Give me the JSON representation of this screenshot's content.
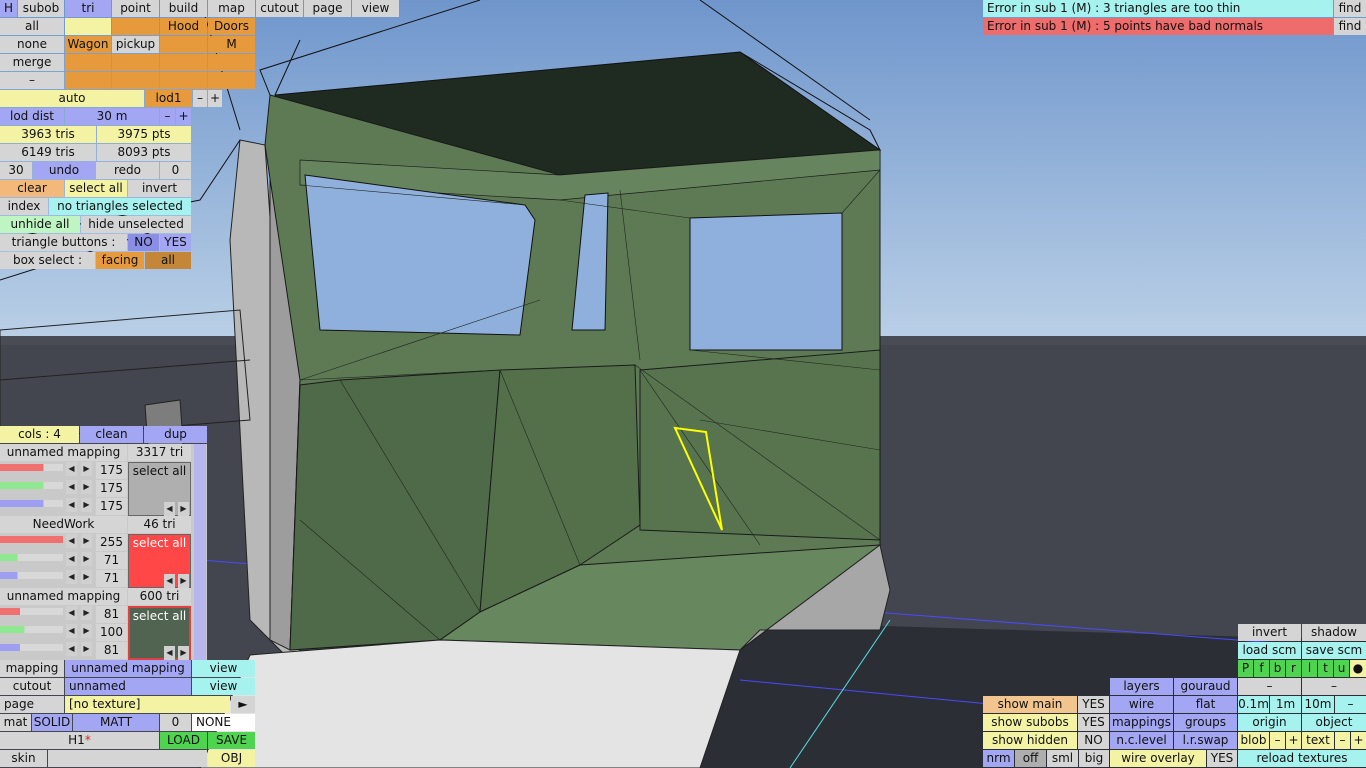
{
  "top_tabs": [
    "H",
    "subob",
    "tri",
    "point",
    "build",
    "map",
    "cutout",
    "page",
    "view"
  ],
  "groups": {
    "row1": [
      "all",
      "",
      "",
      "Hood",
      "Doors"
    ],
    "row2": [
      "none",
      "Wagon",
      "pickup",
      "",
      "M"
    ],
    "row3": [
      "merge",
      "",
      "",
      "",
      ""
    ],
    "row4": [
      "–",
      "",
      "",
      "",
      ""
    ]
  },
  "lod": {
    "auto": "auto",
    "lod": "lod1",
    "minus": "–",
    "plus": "+",
    "dist_label": "lod dist",
    "dist_value": "30 m"
  },
  "stats": {
    "tris1": "3963 tris",
    "pts1": "3975 pts",
    "tris2": "6149 tris",
    "pts2": "8093 pts"
  },
  "undo_row": {
    "count": "30",
    "undo": "undo",
    "redo": "redo",
    "zero": "0"
  },
  "select_row": {
    "clear": "clear",
    "select_all": "select all",
    "invert": "invert"
  },
  "index_row": {
    "index": "index",
    "status": "no triangles selected"
  },
  "hide_row": {
    "unhide": "unhide all",
    "hide": "hide unselected"
  },
  "tri_buttons": {
    "label": "triangle buttons :",
    "no": "NO",
    "yes": "YES"
  },
  "box_select": {
    "label": "box select :",
    "facing": "facing",
    "all": "all"
  },
  "colour_panel": {
    "cols": "cols : 4",
    "clean": "clean",
    "dup": "dup"
  },
  "mappings": [
    {
      "name": "unnamed mapping",
      "tri": "3317 tri",
      "r": "175",
      "g": "175",
      "b": "175",
      "select": "select all",
      "r_frac": 0.69,
      "g_frac": 0.69,
      "b_frac": 0.69,
      "swatch": "#afafaf"
    },
    {
      "name": "NeedWork",
      "tri": "46 tri",
      "r": "255",
      "g": "71",
      "b": "71",
      "select": "select all",
      "r_frac": 1.0,
      "g_frac": 0.28,
      "b_frac": 0.28,
      "swatch": "#ff4747"
    },
    {
      "name": "unnamed mapping",
      "tri": "600 tri",
      "r": "81",
      "g": "100",
      "b": "81",
      "select": "select all",
      "r_frac": 0.32,
      "g_frac": 0.39,
      "b_frac": 0.32,
      "swatch": "#516451"
    }
  ],
  "bottom_left": {
    "mapping_label": "mapping",
    "mapping_value": "unnamed mapping",
    "view1": "view",
    "cutout_label": "cutout",
    "cutout_value": "unnamed",
    "view2": "view",
    "page_label": "page",
    "page_value": "[no texture]",
    "page_arrow": "►",
    "mat": "mat",
    "solid": "SOLID",
    "matt": "MATT",
    "zero": "0",
    "none": "NONE",
    "name": "H1",
    "star": "*",
    "load": "LOAD",
    "save": "SAVE",
    "skin": "skin",
    "obj": "OBJ"
  },
  "errors": [
    {
      "text": "Error in sub 1 (M) : 3 triangles are too thin",
      "find": "find"
    },
    {
      "text": "Error in sub 1 (M) : 5 points have bad normals",
      "find": "find"
    }
  ],
  "bottom_right": {
    "invert": "invert",
    "shadow": "shadow",
    "load_scm": "load scm",
    "save_scm": "save scm",
    "letters": [
      "P",
      "f",
      "b",
      "r",
      "l",
      "t",
      "u",
      "●"
    ],
    "dash1": "–",
    "dash2": "–",
    "layers": "layers",
    "gouraud": "gouraud",
    "show_main": "show main",
    "yes1": "YES",
    "wire": "wire",
    "flat": "flat",
    "d01": "0.1m",
    "d1": "1m",
    "d10": "10m",
    "dm": "–",
    "show_subobs": "show subobs",
    "yes2": "YES",
    "mappings": "mappings",
    "groups": "groups",
    "origin": "origin",
    "object": "object",
    "show_hidden": "show hidden",
    "no": "NO",
    "nclevel": "n.c.level",
    "lrswap": "l.r.swap",
    "blob": "blob",
    "bm": "–",
    "bp": "+",
    "text": "text",
    "tm": "–",
    "tp": "+",
    "nrm": "nrm",
    "off": "off",
    "sml": "sml",
    "big": "big",
    "wire_overlay": "wire overlay",
    "yes3": "YES",
    "reload": "reload textures"
  },
  "colors": {
    "sky": "#87a8d6",
    "ground": "#44464f",
    "body": "#5d7a55",
    "select": "#ffff00"
  }
}
